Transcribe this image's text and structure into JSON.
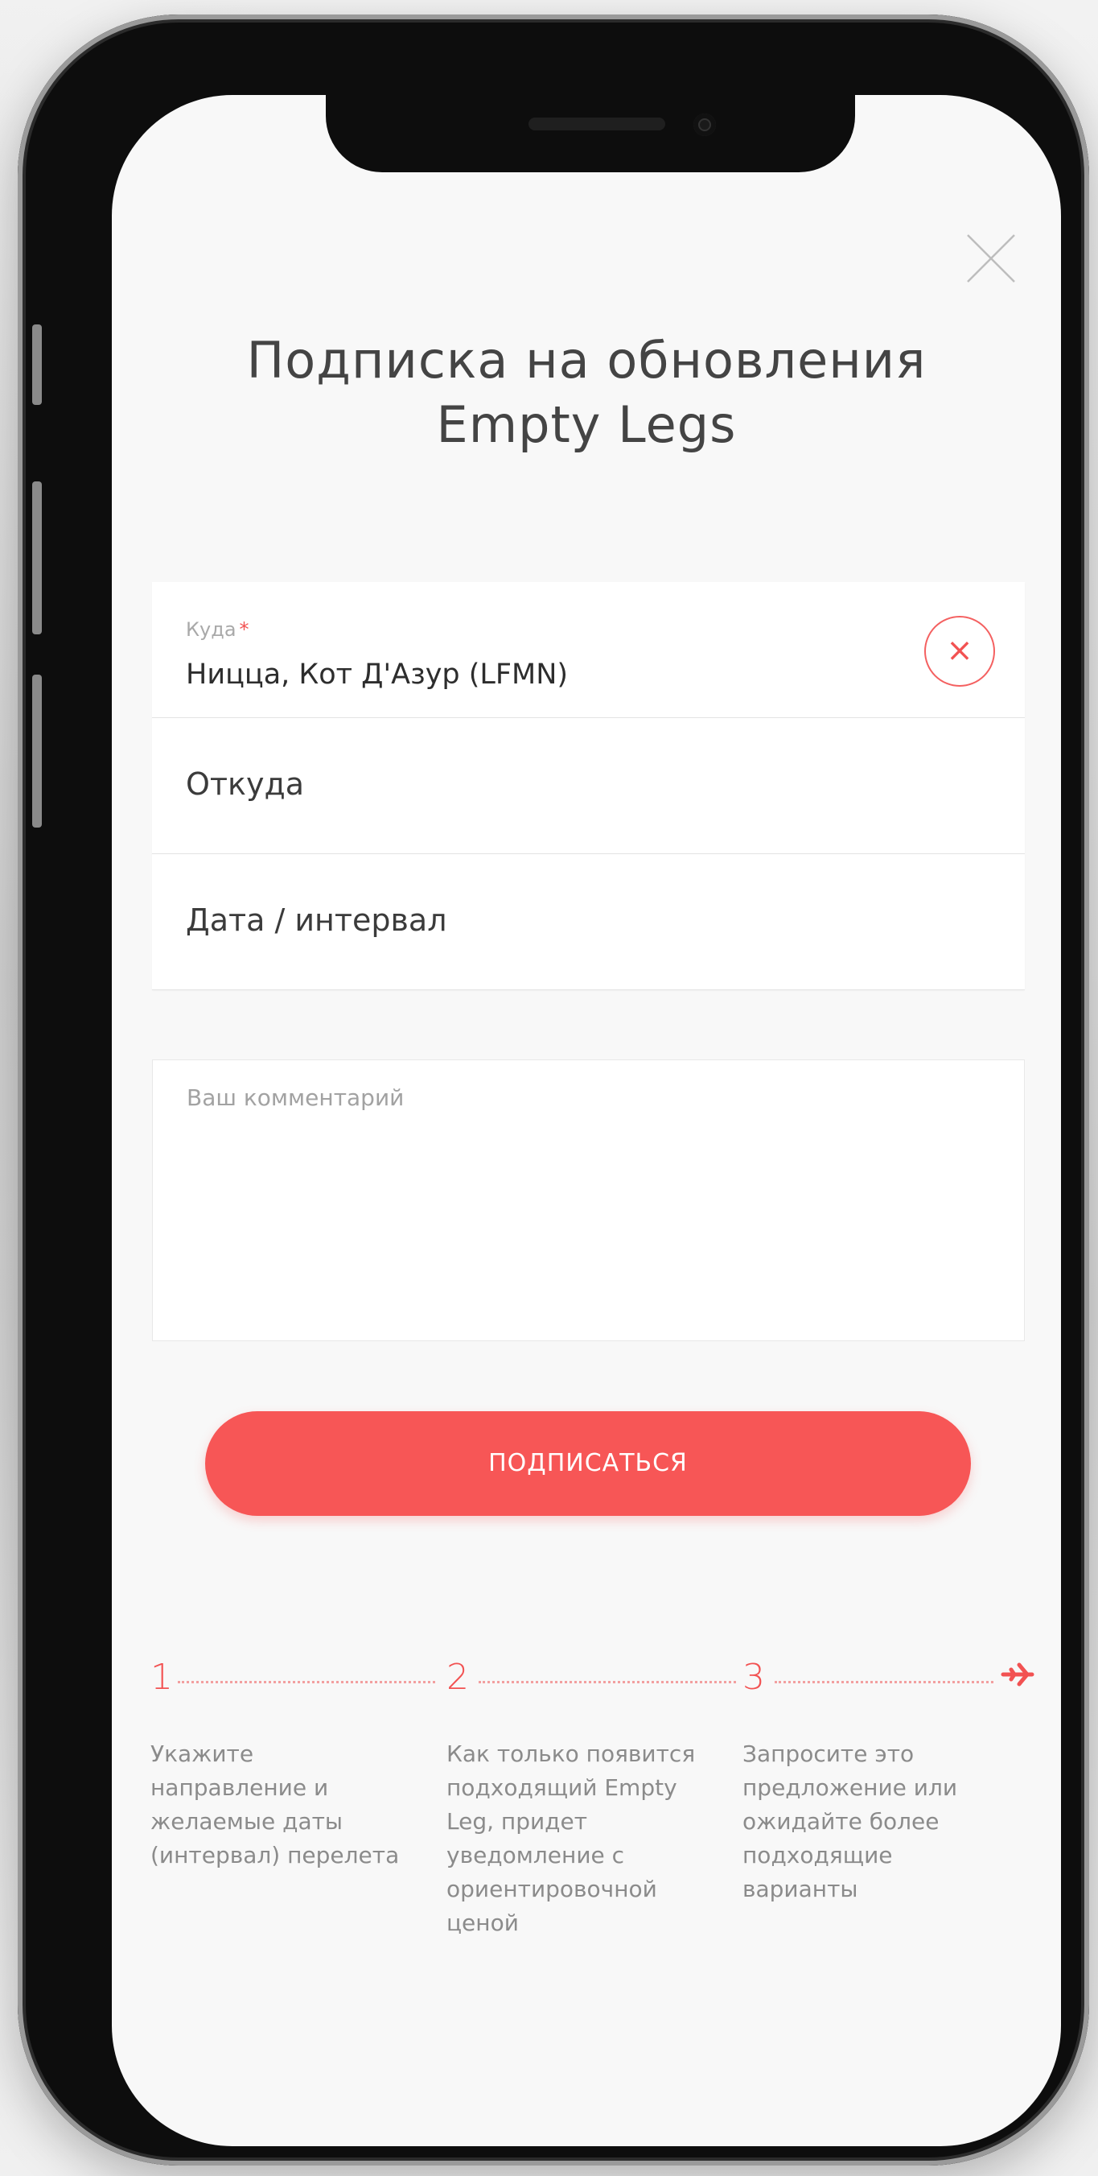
{
  "modal": {
    "title_line1": "Подписка на обновления",
    "title_line2": "Empty Legs",
    "close_icon": "close-icon"
  },
  "form": {
    "to": {
      "label": "Куда",
      "required_mark": "*",
      "value": "Ницца, Кот Д'Азур  (LFMN)",
      "clear_icon": "clear-icon",
      "clear_glyph": "×"
    },
    "from": {
      "placeholder": "Откуда"
    },
    "date": {
      "placeholder": "Дата / интервал"
    },
    "comment": {
      "placeholder": "Ваш комментарий"
    },
    "submit_label": "ПОДПИСАТЬСЯ"
  },
  "steps": [
    {
      "number": "1",
      "text": "Укажите направление и желаемые даты (интервал) перелета"
    },
    {
      "number": "2",
      "text": "Как только появится подходящий Empty Leg, придет уведомление с ориентировочной ценой"
    },
    {
      "number": "3",
      "text": "Запросите это предложение или ожидайте более подходящие варианты"
    }
  ],
  "colors": {
    "accent": "#f25252",
    "button": "#f75656",
    "background": "#f8f8f8",
    "text": "#3a3a3a"
  }
}
